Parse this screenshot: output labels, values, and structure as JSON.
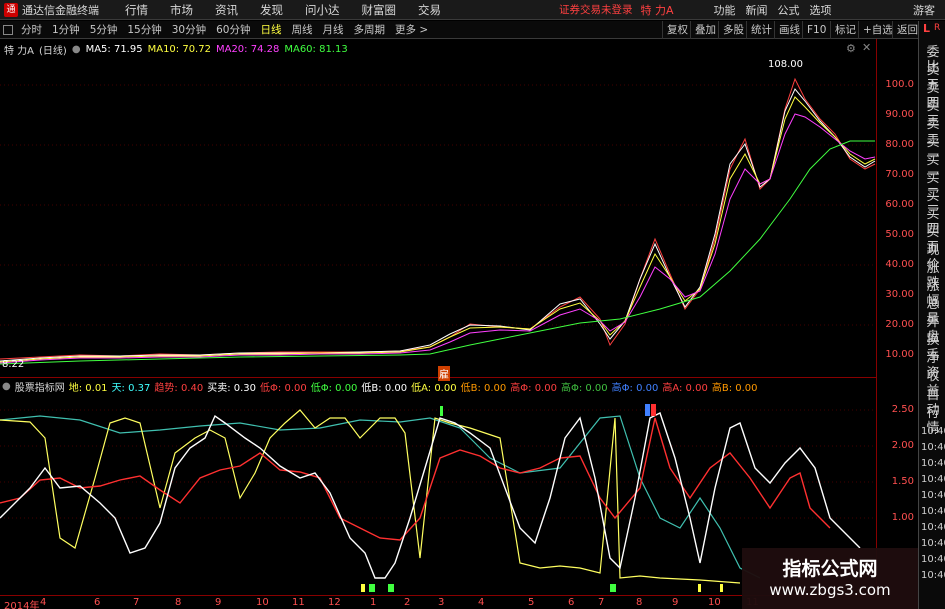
{
  "app": {
    "title": "通达信金融终端",
    "logo_glyph": "通"
  },
  "menu": [
    "行情",
    "市场",
    "资讯",
    "发现",
    "问小达",
    "财富圈",
    "交易"
  ],
  "trade_status": "证券交易未登录",
  "top_stock": "特 力A",
  "right_menu": [
    "功能",
    "新闻",
    "公式",
    "选项"
  ],
  "guest": "游客",
  "periods": [
    "分时",
    "1分钟",
    "5分钟",
    "15分钟",
    "30分钟",
    "60分钟",
    "日线",
    "周线",
    "月线",
    "多周期",
    "更多 >"
  ],
  "active_period": "日线",
  "toolbar": [
    "复权",
    "叠加",
    "多股",
    "统计",
    "画线",
    "F10",
    "标记",
    "+自选",
    "返回"
  ],
  "stock": {
    "name": "特 力A",
    "period_tag": "(日线)"
  },
  "ma_legend": [
    {
      "label": "MA5: 71.95",
      "color": "#ffffff"
    },
    {
      "label": "MA10: 70.72",
      "color": "#ffff40"
    },
    {
      "label": "MA20: 74.28",
      "color": "#ff40ff"
    },
    {
      "label": "MA60: 81.13",
      "color": "#40ff40"
    }
  ],
  "price_axis": [
    "100.0",
    "90.00",
    "80.00",
    "70.00",
    "60.00",
    "50.00",
    "40.00",
    "30.00",
    "20.00",
    "10.00"
  ],
  "price_annotations": {
    "high": "108.00",
    "low": "8.22"
  },
  "event_marker": "雇",
  "indicator": {
    "name": "股票指标网",
    "legend": [
      {
        "label": "地: 0.01",
        "color": "#ffff40"
      },
      {
        "label": "天: 0.37",
        "color": "#40ffff"
      },
      {
        "label": "趋势: 0.40",
        "color": "#ff4040"
      },
      {
        "label": "买卖: 0.30",
        "color": "#ffffff"
      },
      {
        "label": "低Φ: 0.00",
        "color": "#ff4040"
      },
      {
        "label": "低Φ: 0.00",
        "color": "#40ff40"
      },
      {
        "label": "低B: 0.00",
        "color": "#ffffff"
      },
      {
        "label": "低A: 0.00",
        "color": "#ffff40"
      },
      {
        "label": "低B: 0.00",
        "color": "#ff9900"
      },
      {
        "label": "高Φ: 0.00",
        "color": "#ff4040"
      },
      {
        "label": "高Φ: 0.00",
        "color": "#40c040"
      },
      {
        "label": "高Φ: 0.00",
        "color": "#4080ff"
      },
      {
        "label": "高A: 0.00",
        "color": "#ff4040"
      },
      {
        "label": "高B: 0.00",
        "color": "#ff9900"
      }
    ],
    "axis": [
      "2.50",
      "2.00",
      "1.50",
      "1.00"
    ]
  },
  "date_axis": [
    "2014年",
    "4",
    "6",
    "7",
    "8",
    "9",
    "10",
    "11",
    "12",
    "1",
    "2",
    "3",
    "4",
    "5",
    "6",
    "7",
    "8",
    "9",
    "10",
    "11"
  ],
  "side_lr": [
    "L",
    "R"
  ],
  "side_items": [
    "委比",
    "卖五",
    "卖四",
    "卖三",
    "卖二",
    "卖一",
    "买一",
    "买二",
    "买三",
    "买四",
    "买五",
    "现价",
    "涨跌",
    "涨幅",
    "总量",
    "外盘",
    "换手",
    "净资",
    "收益",
    "自动",
    "行情"
  ],
  "side_times": [
    "10:40",
    "10:40",
    "10:40",
    "10:40",
    "10:40",
    "10:40",
    "10:40",
    "10:40",
    "10:40",
    "10:40"
  ],
  "watermark": {
    "title": "指标公式网",
    "url": "www.zbgs3.com"
  }
}
